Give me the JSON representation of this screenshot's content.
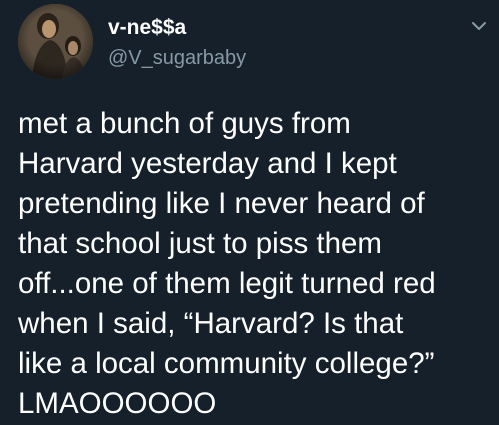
{
  "user": {
    "display_name": "v-ne$$a",
    "handle": "@V_sugarbaby",
    "avatar_icon": "profile-photo"
  },
  "tweet": {
    "lines": [
      "met a bunch of guys from",
      "Harvard yesterday and I kept",
      "pretending like I never heard of",
      "that school just to piss them",
      "off...one of them legit turned red",
      "when I said, “Harvard? Is that",
      "like a local community college?”",
      "LMAOOOOOO"
    ]
  },
  "menu_icon": "chevron-down-icon",
  "colors": {
    "background": "#15202b",
    "text": "#ffffff",
    "secondary_text": "#8899a6"
  }
}
